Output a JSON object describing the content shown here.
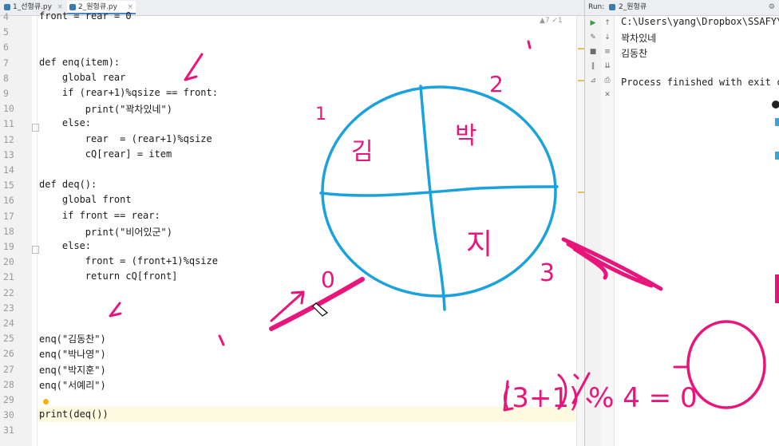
{
  "editor": {
    "tabs": [
      {
        "label": "1_선형큐.py",
        "active": false
      },
      {
        "label": "2_원형큐.py",
        "active": true
      }
    ],
    "inspection_summary": "▲7 ✓1",
    "line_numbers": [
      "4",
      "5",
      "6",
      "7",
      "8",
      "9",
      "10",
      "11",
      "12",
      "13",
      "14",
      "15",
      "16",
      "17",
      "18",
      "19",
      "20",
      "21",
      "22",
      "23",
      "24",
      "25",
      "26",
      "27",
      "28",
      "29",
      "30",
      "31"
    ],
    "lines": [
      {
        "n": "4",
        "text": "front = rear = 0"
      },
      {
        "n": "5",
        "text": ""
      },
      {
        "n": "6",
        "text": ""
      },
      {
        "n": "7",
        "text": "def enq(item):"
      },
      {
        "n": "8",
        "text": "    global rear"
      },
      {
        "n": "9",
        "text": "    if (rear+1)%qsize == front:"
      },
      {
        "n": "10",
        "text": "        print(\"꽉차있네\")"
      },
      {
        "n": "11",
        "text": "    else:"
      },
      {
        "n": "12",
        "text": "        rear  = (rear+1)%qsize"
      },
      {
        "n": "13",
        "text": "        cQ[rear] = item"
      },
      {
        "n": "14",
        "text": ""
      },
      {
        "n": "15",
        "text": "def deq():"
      },
      {
        "n": "16",
        "text": "    global front"
      },
      {
        "n": "17",
        "text": "    if front == rear:"
      },
      {
        "n": "18",
        "text": "        print(\"비어있군\")"
      },
      {
        "n": "19",
        "text": "    else:"
      },
      {
        "n": "20",
        "text": "        front = (front+1)%qsize"
      },
      {
        "n": "21",
        "text": "        return cQ[front]"
      },
      {
        "n": "22",
        "text": ""
      },
      {
        "n": "23",
        "text": ""
      },
      {
        "n": "24",
        "text": ""
      },
      {
        "n": "25",
        "text": "enq(\"김동찬\")"
      },
      {
        "n": "26",
        "text": "enq(\"박나영\")"
      },
      {
        "n": "27",
        "text": "enq(\"박지훈\")"
      },
      {
        "n": "28",
        "text": "enq(\"서예리\")"
      },
      {
        "n": "29",
        "text": ""
      },
      {
        "n": "30",
        "text": "print(deq())"
      },
      {
        "n": "31",
        "text": ""
      }
    ]
  },
  "run": {
    "label": "Run:",
    "config_name": "2_원형큐",
    "output": [
      "C:\\Users\\yang\\Dropbox\\SSAFY\\SSAF",
      "꽉차있네",
      "김동찬",
      "",
      "Process finished with exit code"
    ]
  },
  "annotations": {
    "quadrant_labels": [
      "1",
      "2",
      "3",
      "0"
    ],
    "cell_texts": [
      "김",
      "박",
      "지"
    ],
    "formula": "(3+1) % 4 = 0"
  },
  "colors": {
    "ink_blue": "#1aa2dd",
    "ink_pink": "#e8157a",
    "keyword": "#000080",
    "string": "#008000",
    "number": "#0000ff"
  }
}
